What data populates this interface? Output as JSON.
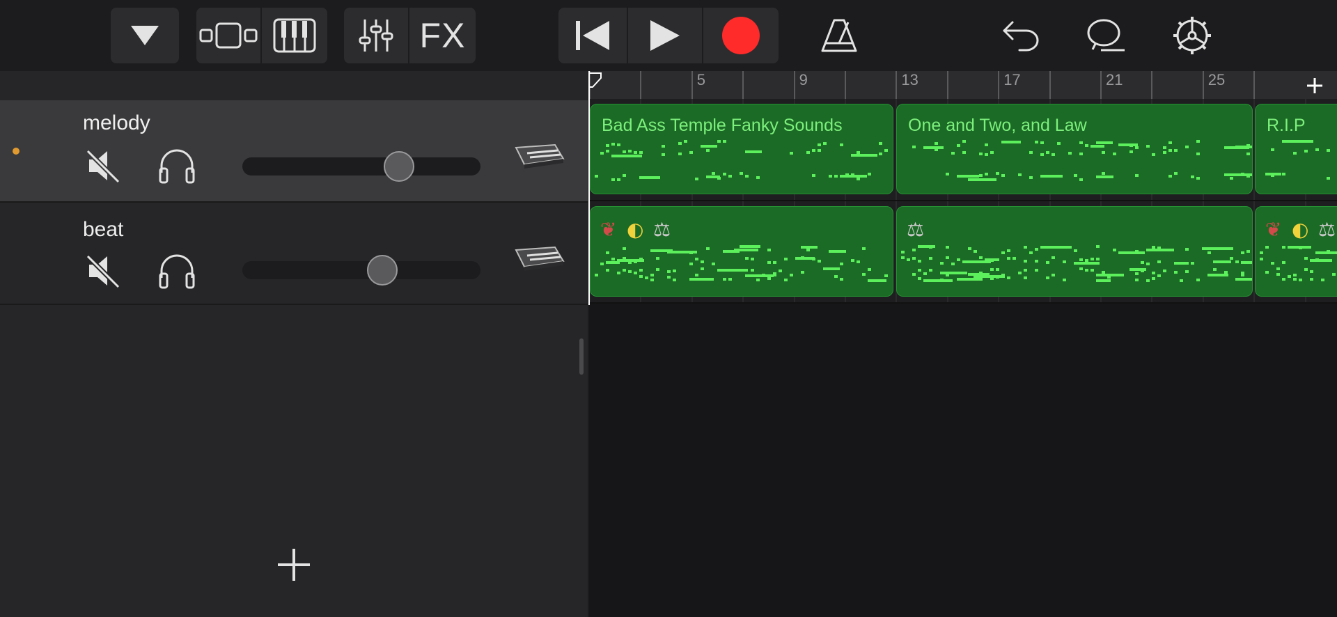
{
  "toolbar": {
    "fx_label": "FX"
  },
  "colors": {
    "record": "#ff2a2a",
    "region_fill": "#1b6a25",
    "region_text": "#7cf07c",
    "notes": "#5df05d",
    "record_dot_indicator": "#e09a2f"
  },
  "ruler": {
    "labels": [
      "5",
      "9",
      "13",
      "17",
      "21",
      "25"
    ],
    "add_label": "+"
  },
  "tracks": [
    {
      "name": "melody",
      "selected": true,
      "armed": true,
      "volume": 0.68,
      "regions": [
        {
          "name": "Bad Ass Temple Fanky Sounds",
          "icons": []
        },
        {
          "name": "One and Two, and Law",
          "icons": []
        },
        {
          "name": "R.I.P",
          "icons": []
        }
      ]
    },
    {
      "name": "beat",
      "selected": false,
      "armed": false,
      "volume": 0.6,
      "regions": [
        {
          "name": "",
          "icons": [
            "mask-icon",
            "moon-icon",
            "scales-icon"
          ]
        },
        {
          "name": "",
          "icons": [
            "scales-icon"
          ]
        },
        {
          "name": "",
          "icons": [
            "mask-icon",
            "moon-icon",
            "scales-icon"
          ]
        }
      ]
    }
  ],
  "add_track_label": "+"
}
